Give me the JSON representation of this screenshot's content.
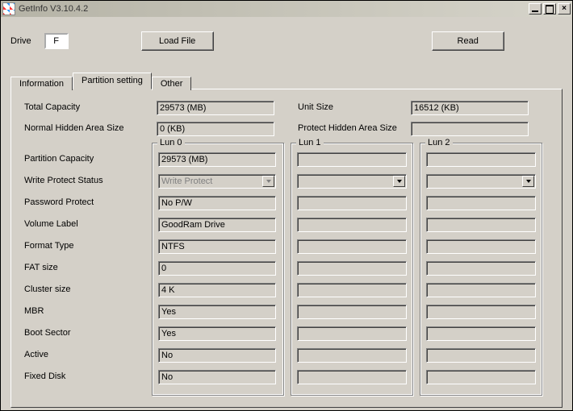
{
  "window": {
    "title": "GetInfo V3.10.4.2"
  },
  "toolbar": {
    "drive_label": "Drive",
    "drive_value": "F",
    "load_label": "Load File",
    "read_label": "Read"
  },
  "tabs": {
    "info": "Information",
    "part": "Partition setting",
    "other": "Other"
  },
  "rows": {
    "total_capacity": "Total Capacity",
    "normal_hidden": "Normal Hidden Area Size",
    "unit_size": "Unit Size",
    "protect_hidden": "Protect Hidden Area Size",
    "partition_capacity": "Partition Capacity",
    "write_protect": "Write Protect Status",
    "password_protect": "Password Protect",
    "volume_label": "Volume Label",
    "format_type": "Format Type",
    "fat_size": "FAT size",
    "cluster_size": "Cluster size",
    "mbr": "MBR",
    "boot_sector": "Boot Sector",
    "active": "Active",
    "fixed_disk": "Fixed Disk"
  },
  "values": {
    "total_capacity": "29573 (MB)",
    "normal_hidden": "0 (KB)",
    "unit_size": "16512 (KB)",
    "protect_hidden": ""
  },
  "luns": {
    "legend0": "Lun 0",
    "legend1": "Lun 1",
    "legend2": "Lun 2"
  },
  "lun0": {
    "partition_capacity": "29573 (MB)",
    "write_protect": "Write Protect",
    "password_protect": "No P/W",
    "volume_label": "GoodRam Drive",
    "format_type": "NTFS",
    "fat_size": "0",
    "cluster_size": "4 K",
    "mbr": "Yes",
    "boot_sector": "Yes",
    "active": "No",
    "fixed_disk": "No"
  }
}
